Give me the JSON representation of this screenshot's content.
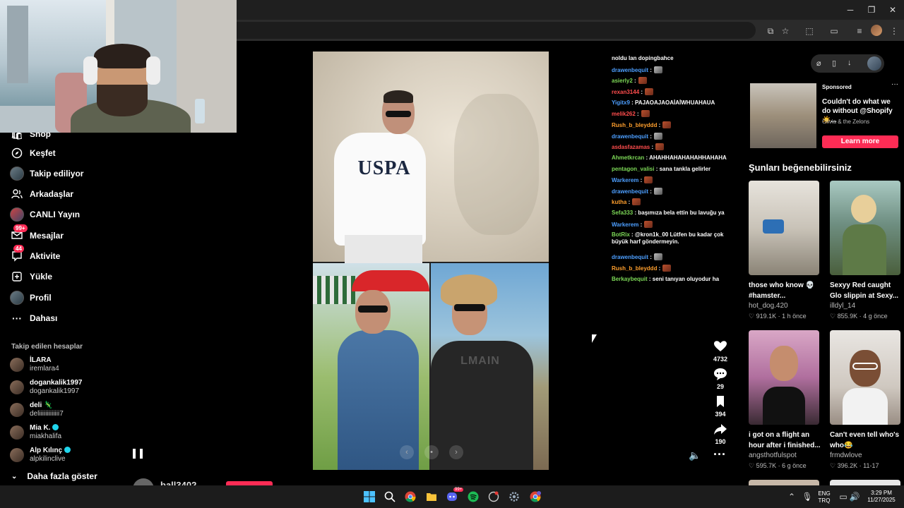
{
  "window": {
    "minimize": "─",
    "maximize": "❐",
    "close": "✕"
  },
  "sidebar": {
    "items": [
      {
        "label": "Shop"
      },
      {
        "label": "Keşfet",
        "icon": "compass-icon"
      },
      {
        "label": "Takip ediliyor",
        "icon": "avatar"
      },
      {
        "label": "Arkadaşlar",
        "icon": "friends-icon"
      },
      {
        "label": "CANLI Yayın",
        "icon": "live-icon"
      },
      {
        "label": "Mesajlar",
        "icon": "messages-icon",
        "badge": "99+"
      },
      {
        "label": "Aktivite",
        "icon": "activity-icon",
        "badge": "44"
      },
      {
        "label": "Yükle",
        "icon": "upload-icon"
      },
      {
        "label": "Profil",
        "icon": "profile-icon"
      },
      {
        "label": "Dahası",
        "icon": "more-icon"
      }
    ],
    "following_title": "Takip edilen hesaplar",
    "following": [
      {
        "name": "İLARA",
        "handle": "iremlara4"
      },
      {
        "name": "dogankalik1997",
        "handle": "dogankalik1997"
      },
      {
        "name": "deli 🦎",
        "handle": "deliiiiiiiiiiiii7"
      },
      {
        "name": "Mia K.",
        "handle": "miakhalifa",
        "verified": true
      },
      {
        "name": "Alp Kılınç",
        "handle": "alpkilinclive",
        "verified": true
      }
    ],
    "more_label": "Daha fazla göster"
  },
  "video": {
    "uspa_text": "USPA",
    "balmain_text": "LMAIN",
    "carousel_prev": "‹",
    "carousel_next": "›",
    "carousel_mid": "•"
  },
  "actions": {
    "likes": "4732",
    "comments": "29",
    "saves": "394",
    "shares": "190"
  },
  "bottom": {
    "username": "ball3402"
  },
  "chat": [
    {
      "user": "noldu lan dopingbahce",
      "color": "#ffffff",
      "msg": ""
    },
    {
      "user": "drawenbequit",
      "color": "#4d9fff",
      "msg": " :",
      "emote": "grey"
    },
    {
      "user": "asierly2",
      "color": "#7dd957",
      "msg": " :",
      "emote": "brown"
    },
    {
      "user": "rexan3144",
      "color": "#ff4d4d",
      "msg": " :",
      "emote": "brown"
    },
    {
      "user": "Yigitx9",
      "color": "#4d9fff",
      "msg": " : PAJAOAJAOAİAİWHUAHAUA"
    },
    {
      "user": "melik262",
      "color": "#ff4d4d",
      "msg": " :",
      "emote": "brown"
    },
    {
      "user": "Rush_b_bleyddd",
      "color": "#ff9f2d",
      "msg": " :",
      "emote": "brown"
    },
    {
      "user": "drawenbequit",
      "color": "#4d9fff",
      "msg": " :",
      "emote": "grey"
    },
    {
      "user": "asdasfazamas",
      "color": "#ff4d4d",
      "msg": " :",
      "emote": "brown"
    },
    {
      "user": "Ahmetkrcan",
      "color": "#7dd957",
      "msg": " : AHAHHAHAHAHAHHAHAHA"
    },
    {
      "user": "pentagon_valisi",
      "color": "#7dd957",
      "msg": " : sana tankla gelirler"
    },
    {
      "user": "Warkerem",
      "color": "#4d9fff",
      "msg": " :",
      "emote": "brown"
    },
    {
      "user": "drawenbequit",
      "color": "#4d9fff",
      "msg": " :",
      "emote": "grey"
    },
    {
      "user": "kutha",
      "color": "#ff9f2d",
      "msg": " :",
      "emote": "brown"
    },
    {
      "user": "Sefa333",
      "color": "#7dd957",
      "msg": " : başımıza bela ettin bu lavuğu ya"
    },
    {
      "user": "Warkerem",
      "color": "#4d9fff",
      "msg": " :",
      "emote": "brown"
    },
    {
      "user": "BotRix",
      "color": "#7dd957",
      "msg": " : @kron1k_00 Lütfen bu kadar çok büyük harf göndermeyin."
    },
    {
      "user": "drawenbequit",
      "color": "#4d9fff",
      "msg": " :",
      "emote": "grey"
    },
    {
      "user": "Rush_b_bleyddd",
      "color": "#ff9f2d",
      "msg": " :",
      "emote": "brown"
    },
    {
      "user": "Berkaybequit",
      "color": "#7dd957",
      "msg": " : seni tanıyan oluyodur ha"
    }
  ],
  "ad": {
    "sponsored": "Sponsored",
    "more": "···",
    "title": "Couldn't do what we do without @Shopify ☀️...",
    "sub": "Olivia & the Zelons",
    "button": "Learn more"
  },
  "suggest": {
    "title": "Şunları beğenebilirsiniz",
    "cards": [
      {
        "title": "those who know 💀 #hamster...",
        "title1": "those who know 💀",
        "title2": "#hamster...",
        "user": "hot_dog.420",
        "likes": "919.1K",
        "age": "1 h önce"
      },
      {
        "title1": "Sexyy Red caught",
        "title2": "Glo slippin at Sexy...",
        "user": "illdyl_14",
        "likes": "855.9K",
        "age": "4 g önce"
      },
      {
        "title1": "i got on a flight an",
        "title2": "hour after i finished...",
        "user": "angsthotfulspot",
        "likes": "595.7K",
        "age": "6 g önce"
      },
      {
        "title1": "Can't even tell who's",
        "title2": "who😂",
        "user": "frmdwlove",
        "likes": "396.2K",
        "age": "11-17"
      }
    ]
  },
  "taskbar": {
    "lang1": "ENG",
    "lang2": "TRQ",
    "time": "3:29 PM",
    "date": "11/27/2025",
    "discord_badge": "99+"
  },
  "colors": {
    "accent": "#fe2c55",
    "background": "#000000",
    "verified": "#20d5ec"
  }
}
